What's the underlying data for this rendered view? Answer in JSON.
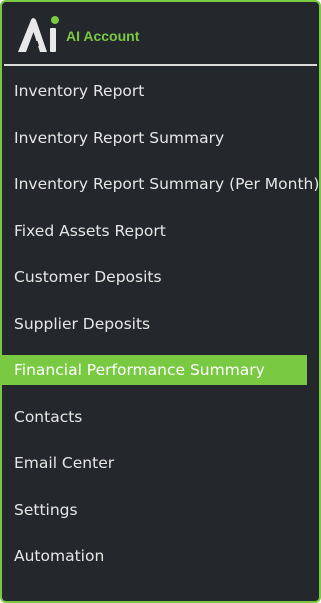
{
  "brand": {
    "logo_icon": "ai-logo-icon",
    "name": "AI Account"
  },
  "colors": {
    "accent": "#7ac943",
    "sidebar_bg": "#24272b",
    "text": "#e6e6e6"
  },
  "menu": {
    "active_index": 6,
    "items": [
      {
        "label": "Inventory Report"
      },
      {
        "label": "Inventory Report Summary"
      },
      {
        "label": "Inventory Report Summary (Per Month)"
      },
      {
        "label": "Fixed Assets Report"
      },
      {
        "label": "Customer Deposits"
      },
      {
        "label": "Supplier Deposits"
      },
      {
        "label": "Financial Performance Summary"
      },
      {
        "label": "Contacts"
      },
      {
        "label": "Email Center"
      },
      {
        "label": "Settings"
      },
      {
        "label": "Automation"
      }
    ]
  }
}
